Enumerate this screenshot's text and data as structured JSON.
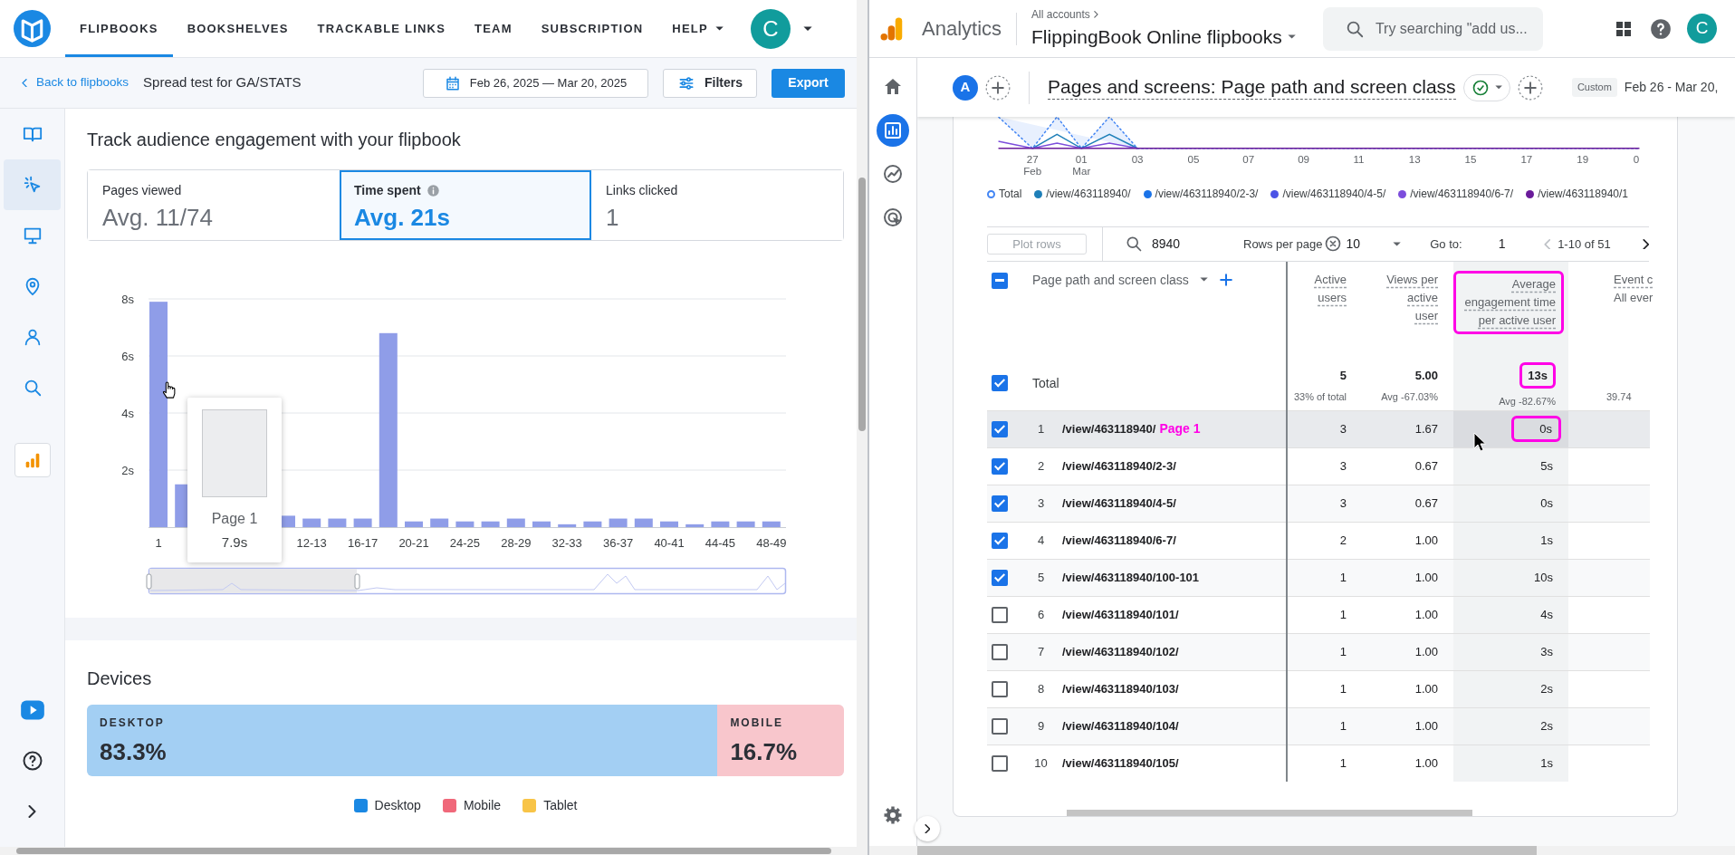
{
  "flipbook_app": {
    "nav": {
      "tabs": [
        {
          "label": "FLIPBOOKS",
          "selected": true,
          "dropdown": false
        },
        {
          "label": "BOOKSHELVES",
          "selected": false,
          "dropdown": false
        },
        {
          "label": "TRACKABLE LINKS",
          "selected": false,
          "dropdown": false
        },
        {
          "label": "TEAM",
          "selected": false,
          "dropdown": false
        },
        {
          "label": "SUBSCRIPTION",
          "selected": false,
          "dropdown": false
        },
        {
          "label": "HELP",
          "selected": false,
          "dropdown": true
        }
      ],
      "avatar": "C"
    },
    "subbar": {
      "back": "Back to flipbooks",
      "title": "Spread test for GA/STATS",
      "date_range": "Feb 26, 2025 — Mar 20, 2025",
      "filters": "Filters",
      "export": "Export"
    },
    "sidebar": {
      "items": [
        {
          "kind": "book",
          "selected": false
        },
        {
          "kind": "cursor",
          "selected": true
        },
        {
          "kind": "monitor",
          "selected": false
        },
        {
          "kind": "pin",
          "selected": false
        },
        {
          "kind": "person",
          "selected": false
        },
        {
          "kind": "search",
          "selected": false
        },
        {
          "kind": "analytics",
          "selected": false
        }
      ],
      "bottom_items": [
        {
          "kind": "video"
        },
        {
          "kind": "help"
        },
        {
          "kind": "expand"
        }
      ]
    },
    "engagement": {
      "title": "Track audience engagement with your flipbook",
      "metrics": [
        {
          "label": "Pages viewed",
          "value": "Avg. 11/74",
          "selected": false,
          "info_icon": false
        },
        {
          "label": "Time spent",
          "value": "Avg. 21s",
          "selected": true,
          "info_icon": true
        },
        {
          "label": "Links clicked",
          "value": "1",
          "selected": false,
          "info_icon": false
        }
      ],
      "chart_data": {
        "type": "bar",
        "ylim": [
          0,
          8
        ],
        "grid": true,
        "categories": [
          "1",
          null,
          null,
          null,
          null,
          null,
          "12-13",
          null,
          "16-17",
          null,
          "20-21",
          null,
          "24-25",
          null,
          "28-29",
          null,
          "32-33",
          null,
          "36-37",
          null,
          "40-41",
          null,
          "44-45",
          null,
          "48-49"
        ],
        "yticks": [
          {
            "value": 2,
            "label": "2s"
          },
          {
            "value": 4,
            "label": "4s"
          },
          {
            "value": 6,
            "label": "6s"
          },
          {
            "value": 8,
            "label": "8s"
          }
        ],
        "values": [
          7.9,
          1.5,
          null,
          null,
          null,
          0.4,
          0.3,
          0.3,
          0.3,
          6.8,
          0.2,
          0.3,
          0.2,
          0.2,
          0.3,
          0.2,
          0.1,
          0.2,
          0.3,
          0.3,
          0.2,
          0.1,
          0.2,
          0.2,
          0.2
        ]
      },
      "tooltip": {
        "label": "Page 1",
        "value": "7.9s"
      }
    },
    "devices": {
      "title": "Devices",
      "segments": [
        {
          "label": "DESKTOP",
          "value": "83.3%",
          "level": 0.833,
          "color": "#a3cff3"
        },
        {
          "label": "MOBILE",
          "value": "16.7%",
          "level": 0.167,
          "color": "#f8c6cc"
        }
      ],
      "legend": [
        {
          "label": "Desktop",
          "color": "#1a88e3"
        },
        {
          "label": "Mobile",
          "color": "#f0687a"
        },
        {
          "label": "Tablet",
          "color": "#f8c447"
        }
      ]
    }
  },
  "analytics": {
    "header": {
      "product": "Analytics",
      "breadcrumb": "All accounts",
      "property": "FlippingBook Online flipbooks",
      "search_placeholder": "Try searching \"add us...",
      "avatar": "C"
    },
    "rail": [
      {
        "kind": "home",
        "selected": false
      },
      {
        "kind": "reports",
        "selected": true
      },
      {
        "kind": "explore",
        "selected": false
      },
      {
        "kind": "advertising",
        "selected": false
      }
    ],
    "report": {
      "comparison": "A",
      "title": "Pages and screens: Page path and screen class",
      "date_chip": "Custom",
      "date_range": "Feb 26 - Mar 20,"
    },
    "line_chart": {
      "x_labels": [
        {
          "day": "27",
          "month": "Feb"
        },
        {
          "day": "01",
          "month": "Mar"
        },
        {
          "day": "03"
        },
        {
          "day": "05"
        },
        {
          "day": "07"
        },
        {
          "day": "09"
        },
        {
          "day": "11"
        },
        {
          "day": "13"
        },
        {
          "day": "15"
        },
        {
          "day": "17"
        },
        {
          "day": "19"
        }
      ],
      "y_label": "0",
      "legend": [
        {
          "label": "Total",
          "color": "#4285f4",
          "kind": "dotted"
        },
        {
          "label": "/view/463118940/",
          "color": "#1e7fb8",
          "kind": "solid"
        },
        {
          "label": "/view/463118940/2-3/",
          "color": "#1a73e8",
          "kind": "solid"
        },
        {
          "label": "/view/463118940/4-5/",
          "color": "#4b53e6",
          "kind": "solid"
        },
        {
          "label": "/view/463118940/6-7/",
          "color": "#7c4ddc",
          "kind": "solid"
        },
        {
          "label": "/view/463118940/1",
          "color": "#6a1b9a",
          "kind": "solid"
        }
      ]
    },
    "toolbar": {
      "plot_rows": "Plot rows",
      "plot_rows_disabled": true,
      "search": "8940",
      "rows_per_page_label": "Rows per page",
      "rows_per_page": "10",
      "goto_label": "Go to:",
      "goto": "1",
      "range": "1-10 of 51"
    },
    "table": {
      "select_all_partial": true,
      "columns": [
        {
          "label": "Page path and screen class",
          "kind": "dimension",
          "marked": false
        },
        {
          "label": "Active users",
          "kind": "metric",
          "marked": false
        },
        {
          "label": "Views per active user",
          "kind": "metric",
          "marked": false
        },
        {
          "label": "Average engagement time per active user",
          "kind": "metric",
          "marked": true
        },
        {
          "label": "Event c",
          "subtitle": "All ever",
          "kind": "metric",
          "marked": false
        }
      ],
      "total": {
        "checked": true,
        "label": "Total",
        "cells": [
          {
            "value": "5",
            "note": "33% of total",
            "marked": false
          },
          {
            "value": "5.00",
            "note": "Avg -67.03%",
            "marked": false
          },
          {
            "value": "13s",
            "note": "Avg -82.67%",
            "marked": true
          },
          {
            "note": "39.74",
            "marked": false
          }
        ]
      },
      "rows": [
        {
          "number": "1",
          "path": "/view/463118940/",
          "annotation": "Page 1",
          "checked": true,
          "hovered": true,
          "values": [
            "3",
            "1.67",
            "0s"
          ],
          "avg_time_marked": true
        },
        {
          "number": "2",
          "path": "/view/463118940/2-3/",
          "checked": true,
          "hovered": false,
          "values": [
            "3",
            "0.67",
            "5s"
          ],
          "avg_time_marked": false
        },
        {
          "number": "3",
          "path": "/view/463118940/4-5/",
          "checked": true,
          "hovered": false,
          "values": [
            "3",
            "0.67",
            "0s"
          ],
          "avg_time_marked": false
        },
        {
          "number": "4",
          "path": "/view/463118940/6-7/",
          "checked": true,
          "hovered": false,
          "values": [
            "2",
            "1.00",
            "1s"
          ],
          "avg_time_marked": false
        },
        {
          "number": "5",
          "path": "/view/463118940/100-101",
          "checked": true,
          "hovered": false,
          "values": [
            "1",
            "1.00",
            "10s"
          ],
          "avg_time_marked": false
        },
        {
          "number": "6",
          "path": "/view/463118940/101/",
          "checked": false,
          "hovered": false,
          "values": [
            "1",
            "1.00",
            "4s"
          ],
          "avg_time_marked": false
        },
        {
          "number": "7",
          "path": "/view/463118940/102/",
          "checked": false,
          "hovered": false,
          "values": [
            "1",
            "1.00",
            "3s"
          ],
          "avg_time_marked": false
        },
        {
          "number": "8",
          "path": "/view/463118940/103/",
          "checked": false,
          "hovered": false,
          "values": [
            "1",
            "1.00",
            "2s"
          ],
          "avg_time_marked": false
        },
        {
          "number": "9",
          "path": "/view/463118940/104/",
          "checked": false,
          "hovered": false,
          "values": [
            "1",
            "1.00",
            "2s"
          ],
          "avg_time_marked": false
        },
        {
          "number": "10",
          "path": "/view/463118940/105/",
          "checked": false,
          "hovered": false,
          "values": [
            "1",
            "1.00",
            "1s"
          ],
          "avg_time_marked": false
        }
      ]
    }
  }
}
